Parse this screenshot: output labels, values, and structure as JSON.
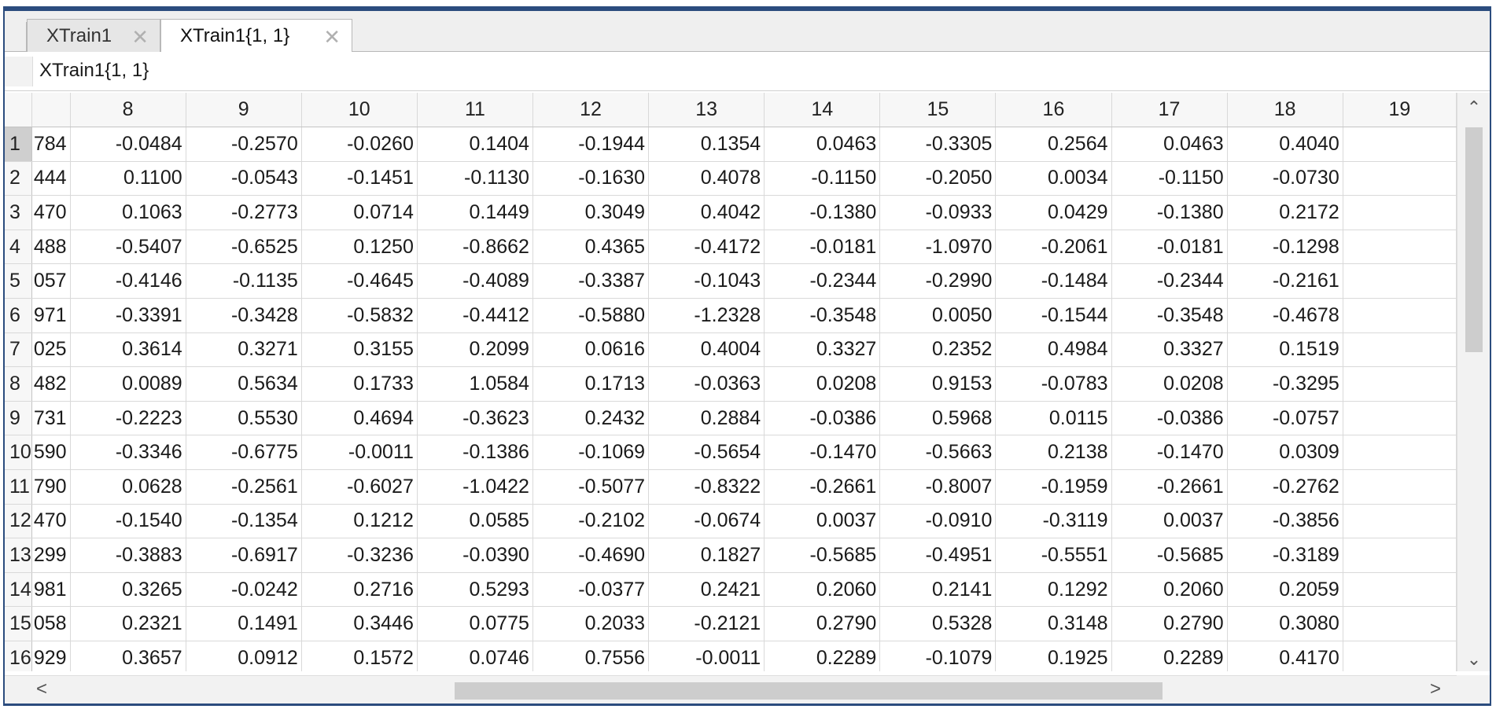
{
  "tabs": [
    {
      "label": "XTrain1",
      "active": false
    },
    {
      "label": "XTrain1{1, 1}",
      "active": true
    }
  ],
  "variable_path": "XTrain1{1, 1}",
  "columns": [
    "8",
    "9",
    "10",
    "11",
    "12",
    "13",
    "14",
    "15",
    "16",
    "17",
    "18",
    "19"
  ],
  "rows": [
    {
      "row": "1",
      "partial": "784",
      "values": [
        "-0.0484",
        "-0.2570",
        "-0.0260",
        "0.1404",
        "-0.1944",
        "0.1354",
        "0.0463",
        "-0.3305",
        "0.2564",
        "0.0463",
        "0.4040"
      ]
    },
    {
      "row": "2",
      "partial": "444",
      "values": [
        "0.1100",
        "-0.0543",
        "-0.1451",
        "-0.1130",
        "-0.1630",
        "0.4078",
        "-0.1150",
        "-0.2050",
        "0.0034",
        "-0.1150",
        "-0.0730"
      ]
    },
    {
      "row": "3",
      "partial": "470",
      "values": [
        "0.1063",
        "-0.2773",
        "0.0714",
        "0.1449",
        "0.3049",
        "0.4042",
        "-0.1380",
        "-0.0933",
        "0.0429",
        "-0.1380",
        "0.2172"
      ]
    },
    {
      "row": "4",
      "partial": "488",
      "values": [
        "-0.5407",
        "-0.6525",
        "0.1250",
        "-0.8662",
        "0.4365",
        "-0.4172",
        "-0.0181",
        "-1.0970",
        "-0.2061",
        "-0.0181",
        "-0.1298"
      ]
    },
    {
      "row": "5",
      "partial": "057",
      "values": [
        "-0.4146",
        "-0.1135",
        "-0.4645",
        "-0.4089",
        "-0.3387",
        "-0.1043",
        "-0.2344",
        "-0.2990",
        "-0.1484",
        "-0.2344",
        "-0.2161"
      ]
    },
    {
      "row": "6",
      "partial": "971",
      "values": [
        "-0.3391",
        "-0.3428",
        "-0.5832",
        "-0.4412",
        "-0.5880",
        "-1.2328",
        "-0.3548",
        "0.0050",
        "-0.1544",
        "-0.3548",
        "-0.4678"
      ]
    },
    {
      "row": "7",
      "partial": "025",
      "values": [
        "0.3614",
        "0.3271",
        "0.3155",
        "0.2099",
        "0.0616",
        "0.4004",
        "0.3327",
        "0.2352",
        "0.4984",
        "0.3327",
        "0.1519"
      ]
    },
    {
      "row": "8",
      "partial": "482",
      "values": [
        "0.0089",
        "0.5634",
        "0.1733",
        "1.0584",
        "0.1713",
        "-0.0363",
        "0.0208",
        "0.9153",
        "-0.0783",
        "0.0208",
        "-0.3295"
      ]
    },
    {
      "row": "9",
      "partial": "731",
      "values": [
        "-0.2223",
        "0.5530",
        "0.4694",
        "-0.3623",
        "0.2432",
        "0.2884",
        "-0.0386",
        "0.5968",
        "0.0115",
        "-0.0386",
        "-0.0757"
      ]
    },
    {
      "row": "10",
      "partial": "590",
      "values": [
        "-0.3346",
        "-0.6775",
        "-0.0011",
        "-0.1386",
        "-0.1069",
        "-0.5654",
        "-0.1470",
        "-0.5663",
        "0.2138",
        "-0.1470",
        "0.0309"
      ]
    },
    {
      "row": "11",
      "partial": "790",
      "values": [
        "0.0628",
        "-0.2561",
        "-0.6027",
        "-1.0422",
        "-0.5077",
        "-0.8322",
        "-0.2661",
        "-0.8007",
        "-0.1959",
        "-0.2661",
        "-0.2762"
      ]
    },
    {
      "row": "12",
      "partial": "470",
      "values": [
        "-0.1540",
        "-0.1354",
        "0.1212",
        "0.0585",
        "-0.2102",
        "-0.0674",
        "0.0037",
        "-0.0910",
        "-0.3119",
        "0.0037",
        "-0.3856"
      ]
    },
    {
      "row": "13",
      "partial": "299",
      "values": [
        "-0.3883",
        "-0.6917",
        "-0.3236",
        "-0.0390",
        "-0.4690",
        "0.1827",
        "-0.5685",
        "-0.4951",
        "-0.5551",
        "-0.5685",
        "-0.3189"
      ]
    },
    {
      "row": "14",
      "partial": "981",
      "values": [
        "0.3265",
        "-0.0242",
        "0.2716",
        "0.5293",
        "-0.0377",
        "0.2421",
        "0.2060",
        "0.2141",
        "0.1292",
        "0.2060",
        "0.2059"
      ]
    },
    {
      "row": "15",
      "partial": "058",
      "values": [
        "0.2321",
        "0.1491",
        "0.3446",
        "0.0775",
        "0.2033",
        "-0.2121",
        "0.2790",
        "0.5328",
        "0.3148",
        "0.2790",
        "0.3080"
      ]
    },
    {
      "row": "16",
      "partial": "929",
      "values": [
        "0.3657",
        "0.0912",
        "0.1572",
        "0.0746",
        "0.7556",
        "-0.0011",
        "0.2289",
        "-0.1079",
        "0.1925",
        "0.2289",
        "0.4170"
      ]
    }
  ],
  "icons": {
    "close": "✕",
    "scroll_up": "⌃",
    "scroll_down": "⌄",
    "scroll_left": "<",
    "scroll_right": ">"
  },
  "colors": {
    "window_border": "#2b4c7e",
    "header_bg": "#f7f7f7",
    "selected_row_header": "#cfcfcf"
  }
}
